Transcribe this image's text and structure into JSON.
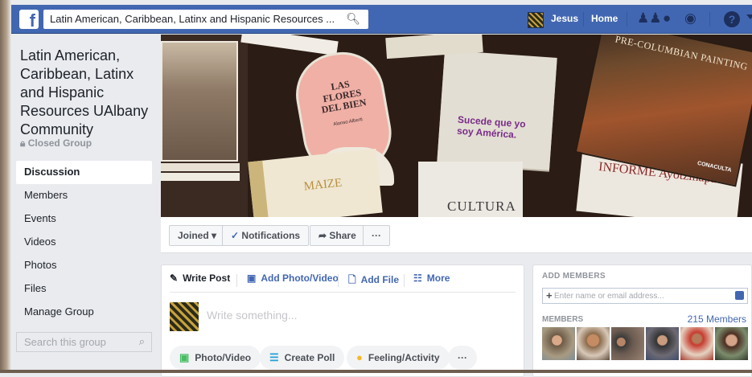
{
  "topbar": {
    "search_query": "Latin American, Caribbean, Latinx and Hispanic Resources ...",
    "user_name": "Jesus",
    "home_label": "Home",
    "icons": [
      "facebook-logo",
      "search-icon",
      "friends-icon",
      "messenger-icon",
      "globe-icon",
      "help-icon",
      "caret-icon"
    ]
  },
  "group": {
    "title": "Latin American, Caribbean, Latinx and Hispanic Resources UAlbany Community",
    "privacy_label": "Closed Group",
    "search_placeholder": "Search this group"
  },
  "nav": {
    "items": [
      {
        "label": "Discussion",
        "active": true
      },
      {
        "label": "Members"
      },
      {
        "label": "Events"
      },
      {
        "label": "Videos"
      },
      {
        "label": "Photos"
      },
      {
        "label": "Files"
      },
      {
        "label": "Manage Group"
      }
    ]
  },
  "cover": {
    "books": [
      "LAS FLORES DEL BIEN",
      "Alonso Alberti",
      "Sucede que yo soy América.",
      "MAIZE",
      "CULTURA",
      "INFORME Ayotzinapa",
      "PRE-COLUMBIAN PAINTING",
      "CONACULTA"
    ]
  },
  "actions": {
    "joined_label": "Joined",
    "notifications_label": "Notifications",
    "share_label": "Share",
    "more_label": "···"
  },
  "composer": {
    "tabs": [
      {
        "label": "Write Post",
        "icon": "pencil-icon"
      },
      {
        "label": "Add Photo/Video",
        "icon": "camera-icon"
      },
      {
        "label": "Add File",
        "icon": "file-icon"
      },
      {
        "label": "More",
        "icon": "more-icon"
      }
    ],
    "placeholder": "Write something...",
    "chips": [
      {
        "label": "Photo/Video",
        "icon": "photo-icon"
      },
      {
        "label": "Create Poll",
        "icon": "poll-icon"
      },
      {
        "label": "Feeling/Activity",
        "icon": "smiley-icon"
      },
      {
        "label": "···",
        "icon": ""
      }
    ]
  },
  "sidebar_right": {
    "add_members_heading": "ADD MEMBERS",
    "add_members_placeholder": "Enter name or email address...",
    "members_heading": "MEMBERS",
    "members_count": "215 Members",
    "member_faces": 6
  },
  "colors": {
    "brand_blue": "#4267b2",
    "background": "#e9ebee",
    "text": "#1d2129",
    "secondary_text": "#90949c"
  }
}
